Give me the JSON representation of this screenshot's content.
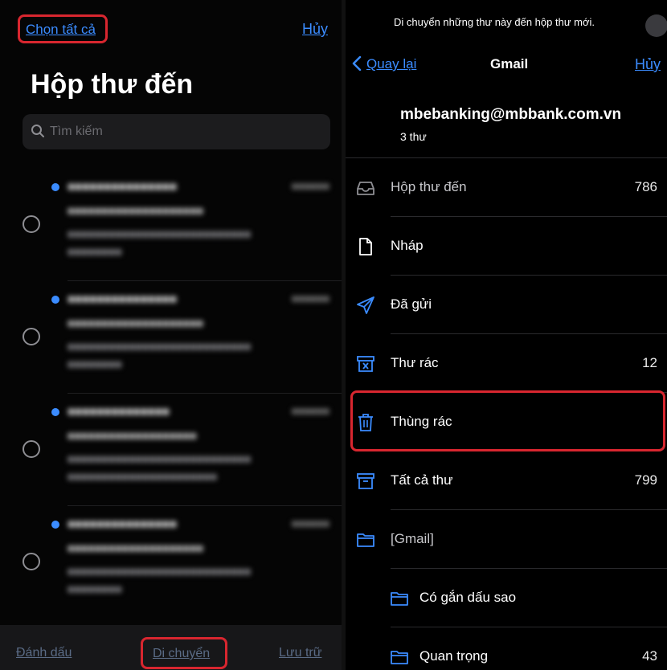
{
  "left": {
    "select_all": "Chọn tất cả",
    "cancel": "Hủy",
    "title": "Hộp thư đến",
    "search_placeholder": "Tìm kiếm",
    "bottom_bar": {
      "mark": "Đánh dấu",
      "move": "Di chuyển",
      "archive": "Lưu trữ"
    }
  },
  "right": {
    "hint": "Di chuyển những thư này đến hộp thư mới.",
    "back": "Quay lại",
    "title": "Gmail",
    "cancel": "Hủy",
    "account": "mbebanking@mbbank.com.vn",
    "message_count": "3 thư",
    "mailboxes": [
      {
        "label": "Hộp thư đến",
        "count": "786",
        "icon": "inbox-icon"
      },
      {
        "label": "Nháp",
        "count": "",
        "icon": "draft-icon"
      },
      {
        "label": "Đã gửi",
        "count": "",
        "icon": "sent-icon"
      },
      {
        "label": "Thư rác",
        "count": "12",
        "icon": "junk-icon"
      },
      {
        "label": "Thùng rác",
        "count": "",
        "icon": "trash-icon"
      },
      {
        "label": "Tất cả thư",
        "count": "799",
        "icon": "archive-icon"
      },
      {
        "label": "[Gmail]",
        "count": "",
        "icon": "folder-icon"
      },
      {
        "label": "Có gắn dấu sao",
        "count": "",
        "icon": "folder-icon"
      },
      {
        "label": "Quan trọng",
        "count": "43",
        "icon": "folder-icon"
      }
    ]
  },
  "colors": {
    "accent": "#3b8cff",
    "highlight": "#d8262f",
    "background": "#000000"
  }
}
